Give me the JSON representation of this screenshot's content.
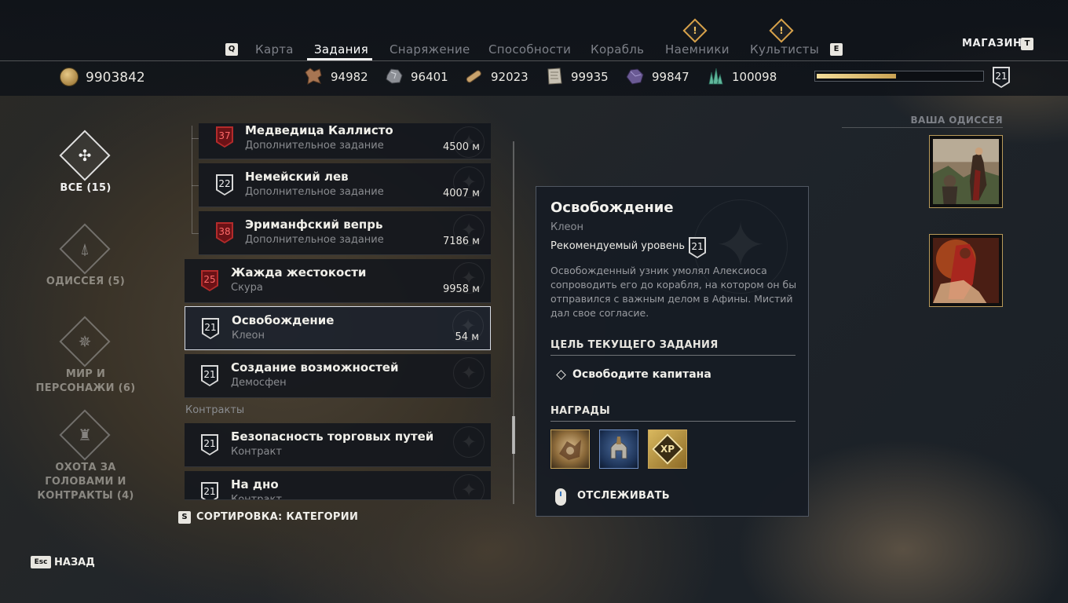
{
  "top_nav": {
    "prev_key": "Q",
    "next_key": "E",
    "tabs": [
      {
        "label": "Карта"
      },
      {
        "label": "Задания"
      },
      {
        "label": "Снаряжение"
      },
      {
        "label": "Способности"
      },
      {
        "label": "Корабль"
      },
      {
        "label": "Наемники"
      },
      {
        "label": "Культисты"
      }
    ],
    "alert_glyph": "!",
    "shop_label": "МАГАЗИН",
    "shop_key": "T"
  },
  "resources": {
    "drachmae": "9903842",
    "items": [
      {
        "icon": "leather-icon",
        "value": "94982"
      },
      {
        "icon": "iron-ore-icon",
        "value": "96401"
      },
      {
        "icon": "wood-icon",
        "value": "92023"
      },
      {
        "icon": "ancient-tablet-icon",
        "value": "99935"
      },
      {
        "icon": "obsidian-icon",
        "value": "99847"
      },
      {
        "icon": "crystal-icon",
        "value": "100098"
      }
    ],
    "xp_fraction": 0.48,
    "player_level": "21"
  },
  "categories": [
    {
      "label": "ВСЕ (15)",
      "icon": "all-quests-icon"
    },
    {
      "label": "ОДИССЕЯ (5)",
      "icon": "odyssey-icon"
    },
    {
      "label": "МИР И ПЕРСОНАЖИ (6)",
      "icon": "world-characters-icon"
    },
    {
      "label": "ОХОТА ЗА ГОЛОВАМИ И КОНТРАКТЫ (4)",
      "icon": "bounty-contracts-icon"
    }
  ],
  "quests": [
    {
      "level": "37",
      "title": "Медведица Каллисто",
      "type": "Дополнительное задание",
      "distance": "4500 м"
    },
    {
      "level": "22",
      "title": "Немейский лев",
      "type": "Дополнительное задание",
      "distance": "4007 м"
    },
    {
      "level": "38",
      "title": "Эриманфский вепрь",
      "type": "Дополнительное задание",
      "distance": "7186 м"
    },
    {
      "level": "25",
      "title": "Жажда жестокости",
      "type": "Скура",
      "distance": "9958 м"
    },
    {
      "level": "21",
      "title": "Освобождение",
      "type": "Клеон",
      "distance": "54 м"
    },
    {
      "level": "21",
      "title": "Создание возможностей",
      "type": "Демосфен",
      "distance": ""
    }
  ],
  "contracts_label": "Контракты",
  "contracts": [
    {
      "level": "21",
      "title": "Безопасность торговых путей",
      "type": "Контракт"
    },
    {
      "level": "21",
      "title": "На дно",
      "type": "Контракт"
    }
  ],
  "sort": {
    "key": "S",
    "label": "СОРТИРОВКА: КАТЕГОРИИ"
  },
  "back": {
    "key": "Esc",
    "label": "НАЗАД"
  },
  "detail": {
    "title": "Освобождение",
    "giver": "Клеон",
    "recommended_label": "Рекомендуемый уровень",
    "recommended_level": "21",
    "description": "Освобожденный узник умолял Алексиоса сопроводить его до корабля, на котором он бы отправился с важным делом в Афины. Мистий дал свое согласие.",
    "objective_header": "ЦЕЛЬ ТЕКУЩЕГО ЗАДАНИЯ",
    "objective": "Освободите капитана",
    "rewards_header": "НАГРАДЫ",
    "rewards": [
      {
        "icon": "engraving-reward-icon"
      },
      {
        "icon": "helmet-reward-icon"
      },
      {
        "icon": "xp-reward-icon",
        "label": "XP"
      }
    ],
    "track_label": "ОТСЛЕЖИВАТЬ"
  },
  "odyssey": {
    "title": "ВАША ОДИССЕЯ"
  },
  "colors": {
    "accent_gold": "#c9a559",
    "danger_red": "#b32b2b",
    "panel_bg": "#161c24"
  }
}
